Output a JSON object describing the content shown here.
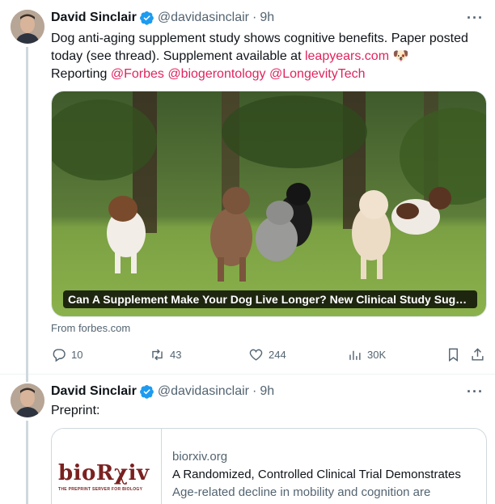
{
  "colors": {
    "link": "#e0245e",
    "verified": "#1d9bf0",
    "secondary": "#536471"
  },
  "tweet1": {
    "name": "David Sinclair",
    "handle": "@davidasinclair",
    "dot": "·",
    "time": "9h",
    "more": "···",
    "text_part1": "Dog anti-aging supplement study shows cognitive benefits. Paper posted today (see thread). Supplement available at ",
    "link_url": "leapyears.com",
    "emoji": "🐶",
    "reporting_prefix": "Reporting ",
    "mention_1": "@Forbes",
    "mention_2": "@biogerontology",
    "mention_3": "@LongevityTech",
    "card_caption": "Can A Supplement Make Your Dog Live Longer? New Clinical Study Suggests Th...",
    "card_from": "From forbes.com",
    "actions": {
      "replies": "10",
      "retweets": "43",
      "likes": "244",
      "views": "30K"
    }
  },
  "tweet2": {
    "name": "David Sinclair",
    "handle": "@davidasinclair",
    "dot": "·",
    "time": "9h",
    "more": "···",
    "text": "Preprint:",
    "card": {
      "logo_text": "bioRχiv",
      "logo_tagline": "THE PREPRINT SERVER FOR BIOLOGY",
      "domain": "biorxiv.org",
      "title": "A Randomized, Controlled Clinical Trial Demonstrates",
      "description": "Age-related decline in mobility and cognition are"
    }
  }
}
